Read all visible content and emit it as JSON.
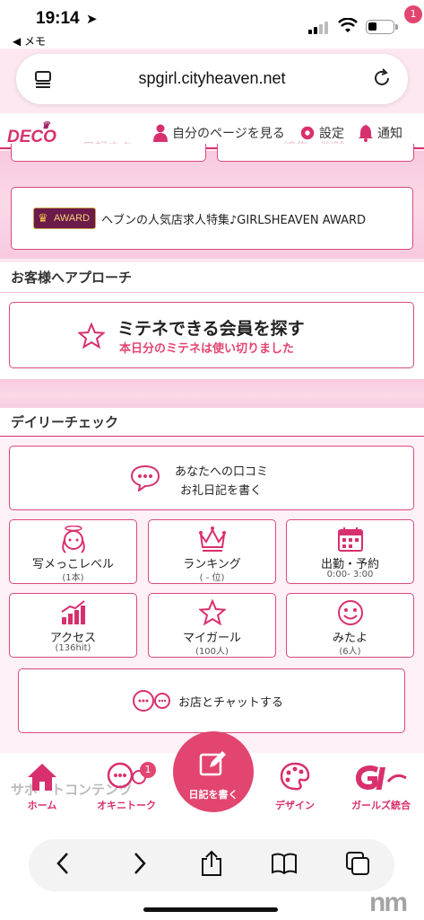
{
  "status": {
    "time": "19:14",
    "back_label": "◀ メモ"
  },
  "browser": {
    "url": "spgirl.cityheaven.net"
  },
  "header": {
    "logo": "DECO",
    "my_page": "自分のページを見る",
    "settings": "設定",
    "notifications": "通知",
    "notification_count": "1",
    "ghost_left": "日記ネタ",
    "ghost_right": "編集・削除"
  },
  "award": {
    "badge": "AWARD",
    "text": "ヘブンの人気店求人特集♪GIRLSHEAVEN AWARD"
  },
  "approach": {
    "heading": "お客様へアプローチ",
    "button_title": "ミテネできる会員を探す",
    "button_note": "本日分のミテネは使い切りました"
  },
  "daily": {
    "heading": "デイリーチェック",
    "review_line1": "あなたへの口コミ",
    "review_line2": "お礼日記を書く",
    "items": [
      {
        "label": "写メっこレベル",
        "sub": "(1本)"
      },
      {
        "label": "ランキング",
        "sub": "( - 位)"
      },
      {
        "label": "出勤・予約",
        "sub": "0:00- 3:00"
      },
      {
        "label": "アクセス",
        "sub": "(136hit)"
      },
      {
        "label": "マイガール",
        "sub": "(100人)"
      },
      {
        "label": "みたよ",
        "sub": "(6人)"
      }
    ],
    "chat": "お店とチャットする"
  },
  "tabs": {
    "ghost": "サポートコンテンツ",
    "home": "ホーム",
    "talk": "オキニトーク",
    "talk_badge": "1",
    "write": "日記を書く",
    "design": "デザイン",
    "girls": "ガールズ統合"
  },
  "colors": {
    "accent": "#d8306e",
    "badge": "#e2456f"
  }
}
